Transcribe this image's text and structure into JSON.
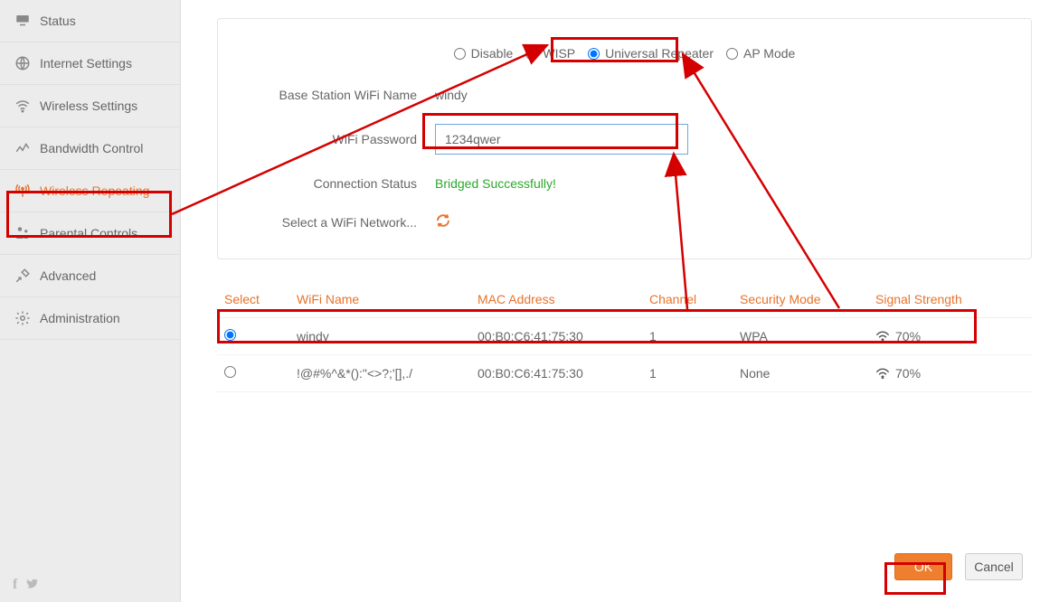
{
  "sidebar": {
    "items": [
      {
        "label": "Status"
      },
      {
        "label": "Internet Settings"
      },
      {
        "label": "Wireless Settings"
      },
      {
        "label": "Bandwidth Control"
      },
      {
        "label": "Wireless Repeating"
      },
      {
        "label": "Parental Controls"
      },
      {
        "label": "Advanced"
      },
      {
        "label": "Administration"
      }
    ]
  },
  "modes": {
    "disable": "Disable",
    "wisp": "WISP",
    "universal": "Universal Repeater",
    "ap": "AP Mode"
  },
  "form": {
    "bssid_label": "Base Station WiFi Name",
    "bssid_value": "windy",
    "pwd_label": "WiFi Password",
    "pwd_value": "1234qwer",
    "status_label": "Connection Status",
    "status_value": "Bridged Successfully!",
    "select_label": "Select a WiFi Network..."
  },
  "table": {
    "headers": {
      "select": "Select",
      "name": "WiFi Name",
      "mac": "MAC Address",
      "channel": "Channel",
      "security": "Security Mode",
      "signal": "Signal Strength"
    },
    "rows": [
      {
        "selected": true,
        "name": "windy",
        "mac": "00:B0:C6:41:75:30",
        "channel": "1",
        "security": "WPA",
        "signal": "70%"
      },
      {
        "selected": false,
        "name": "!@#%^&*():\"<>?;'[],./",
        "mac": "00:B0:C6:41:75:30",
        "channel": "1",
        "security": "None",
        "signal": "70%"
      }
    ]
  },
  "buttons": {
    "ok": "OK",
    "cancel": "Cancel"
  }
}
